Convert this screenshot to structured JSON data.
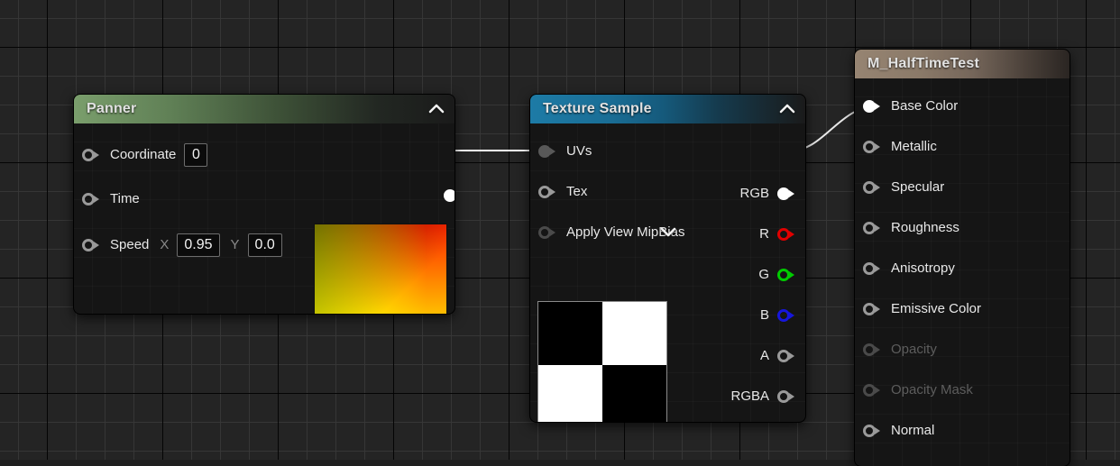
{
  "canvas": {
    "background_color": "#242424",
    "grid_minor_color": "#373737",
    "grid_major_color": "#000000"
  },
  "nodes": [
    {
      "id": "panner",
      "title": "Panner",
      "header_color": "#6f8f62",
      "collapse_icon": "chevron-up-icon",
      "inputs": [
        {
          "label": "Coordinate",
          "pin_state": "unconnected",
          "field_value": "0"
        },
        {
          "label": "Time",
          "pin_state": "unconnected"
        },
        {
          "label": "Speed",
          "axis_x_label": "X",
          "axis_x_value": "0.95",
          "axis_y_label": "Y",
          "axis_y_value": "0.0",
          "pin_state": "unconnected"
        }
      ],
      "outputs": [
        {
          "label": "",
          "pin_state": "connected"
        }
      ],
      "preview": "gradient-swatch"
    },
    {
      "id": "texture_sample",
      "title": "Texture Sample",
      "header_color": "#1b6f96",
      "collapse_icon": "chevron-up-icon",
      "expand_icon": "chevron-down-icon",
      "inputs": [
        {
          "label": "UVs",
          "pin_state": "connected-gray"
        },
        {
          "label": "Tex",
          "pin_state": "unconnected"
        },
        {
          "label": "Apply View MipBias",
          "pin_state": "unconnected"
        }
      ],
      "outputs": [
        {
          "label": "RGB",
          "pin_state": "connected",
          "color": "#ffffff"
        },
        {
          "label": "R",
          "pin_state": "unconnected",
          "color": "#e10000"
        },
        {
          "label": "G",
          "pin_state": "unconnected",
          "color": "#00cc00"
        },
        {
          "label": "B",
          "pin_state": "unconnected",
          "color": "#1616dd"
        },
        {
          "label": "A",
          "pin_state": "unconnected",
          "color": "#9a9a9a"
        },
        {
          "label": "RGBA",
          "pin_state": "unconnected",
          "color": "#9a9a9a"
        }
      ],
      "preview": "checkerboard-2x2"
    },
    {
      "id": "material_output",
      "title": "M_HalfTimeTest",
      "header_color": "#8a7a68",
      "inputs": [
        {
          "label": "Base Color",
          "pin_state": "connected",
          "enabled": true
        },
        {
          "label": "Metallic",
          "pin_state": "unconnected",
          "enabled": true
        },
        {
          "label": "Specular",
          "pin_state": "unconnected",
          "enabled": true
        },
        {
          "label": "Roughness",
          "pin_state": "unconnected",
          "enabled": true
        },
        {
          "label": "Anisotropy",
          "pin_state": "unconnected",
          "enabled": true
        },
        {
          "label": "Emissive Color",
          "pin_state": "unconnected",
          "enabled": true
        },
        {
          "label": "Opacity",
          "pin_state": "unconnected",
          "enabled": false
        },
        {
          "label": "Opacity Mask",
          "pin_state": "unconnected",
          "enabled": false
        },
        {
          "label": "Normal",
          "pin_state": "unconnected",
          "enabled": true
        }
      ]
    }
  ],
  "connections": [
    {
      "from": "panner.output",
      "to": "texture_sample.UVs",
      "color": "#ffffff",
      "style": "straight"
    },
    {
      "from": "texture_sample.RGB",
      "to": "material_output.Base Color",
      "color": "#ffffff",
      "style": "bezier"
    }
  ]
}
